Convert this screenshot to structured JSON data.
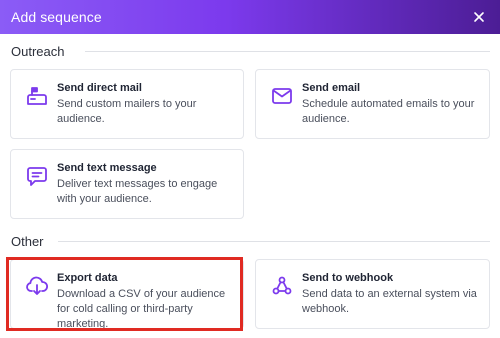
{
  "dialog": {
    "title": "Add sequence",
    "close_icon": "close-icon"
  },
  "sections": [
    {
      "label": "Outreach",
      "cards": [
        {
          "title": "Send direct mail",
          "description": "Send custom mailers to your audience.",
          "icon": "mailbox-icon"
        },
        {
          "title": "Send email",
          "description": "Schedule automated emails to your audience.",
          "icon": "envelope-icon"
        },
        {
          "title": "Send text message",
          "description": "Deliver text messages to engage with your audience.",
          "icon": "chat-bubble-icon"
        }
      ]
    },
    {
      "label": "Other",
      "cards": [
        {
          "title": "Export data",
          "description": "Download a CSV of your audience for cold calling or third-party marketing.",
          "icon": "cloud-download-icon"
        },
        {
          "title": "Send to webhook",
          "description": "Send data to an external system via webhook.",
          "icon": "webhook-icon"
        }
      ]
    }
  ],
  "colors": {
    "accent": "#7c3aed",
    "highlight": "#e02a22"
  }
}
